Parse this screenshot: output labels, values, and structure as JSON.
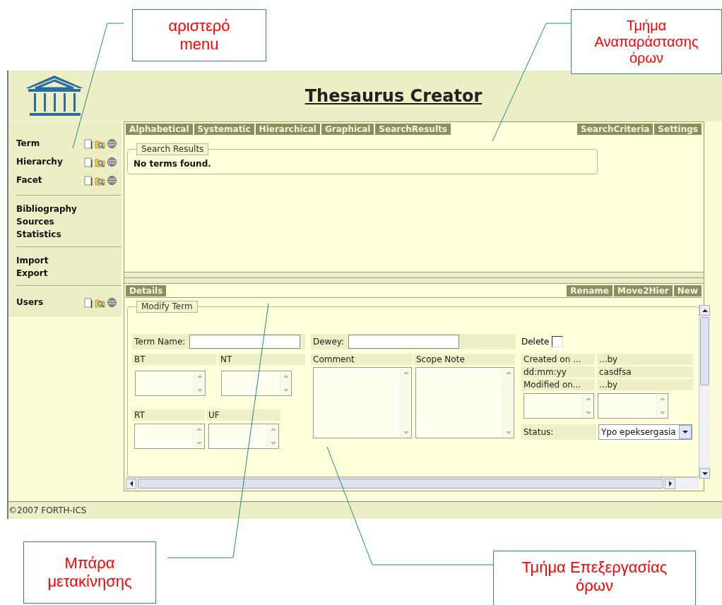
{
  "annotations": [
    {
      "text": "αριστερό\nmenu"
    },
    {
      "text": "Τμήμα\nΑναπαράστασης\nόρων"
    },
    {
      "text": "Μπάρα\nμετακίνησης"
    },
    {
      "text": "Τμήμα Επεξεργασίας\nόρων"
    }
  ],
  "header": {
    "title": "Thesaurus Creator"
  },
  "sidebar": {
    "groups": [
      [
        {
          "label": "Term",
          "kind": "entity"
        },
        {
          "label": "Hierarchy",
          "kind": "entity"
        },
        {
          "label": "Facet",
          "kind": "entity"
        }
      ],
      [
        {
          "label": "Bibliography",
          "kind": "link"
        },
        {
          "label": "Sources",
          "kind": "link"
        },
        {
          "label": "Statistics",
          "kind": "link"
        }
      ],
      [
        {
          "label": "Import",
          "kind": "link"
        },
        {
          "label": "Export",
          "kind": "link"
        }
      ],
      [
        {
          "label": "Users",
          "kind": "entity"
        }
      ]
    ]
  },
  "top_tabs": {
    "left": [
      "Alphabetical",
      "Systematic",
      "Hierarchical",
      "Graphical",
      "SearchResults"
    ],
    "right": [
      "SearchCriteria",
      "Settings"
    ]
  },
  "search_results": {
    "legend": "Search Results",
    "message": "No terms found."
  },
  "bottom_tabs": {
    "left": [
      "Details"
    ],
    "right": [
      "Rename",
      "Move2Hier",
      "New"
    ]
  },
  "modify_term": {
    "legend": "Modify Term",
    "term_name_label": "Term Name:",
    "dewey_label": "Dewey:",
    "delete": {
      "label": "Delete",
      "checked": false
    },
    "bt_label": "BT",
    "nt_label": "NT",
    "rt_label": "RT",
    "uf_label": "UF",
    "comment_label": "Comment",
    "scope_note_label": "Scope Note",
    "info": [
      [
        "Created on ...",
        "...by"
      ],
      [
        "dd:mm:yy",
        "casdfsa"
      ],
      [
        "Modified on...",
        "...by"
      ]
    ],
    "status_label": "Status:",
    "status_value": "Ypo epeksergasia"
  },
  "footer": "©2007 FORTH-ICS"
}
